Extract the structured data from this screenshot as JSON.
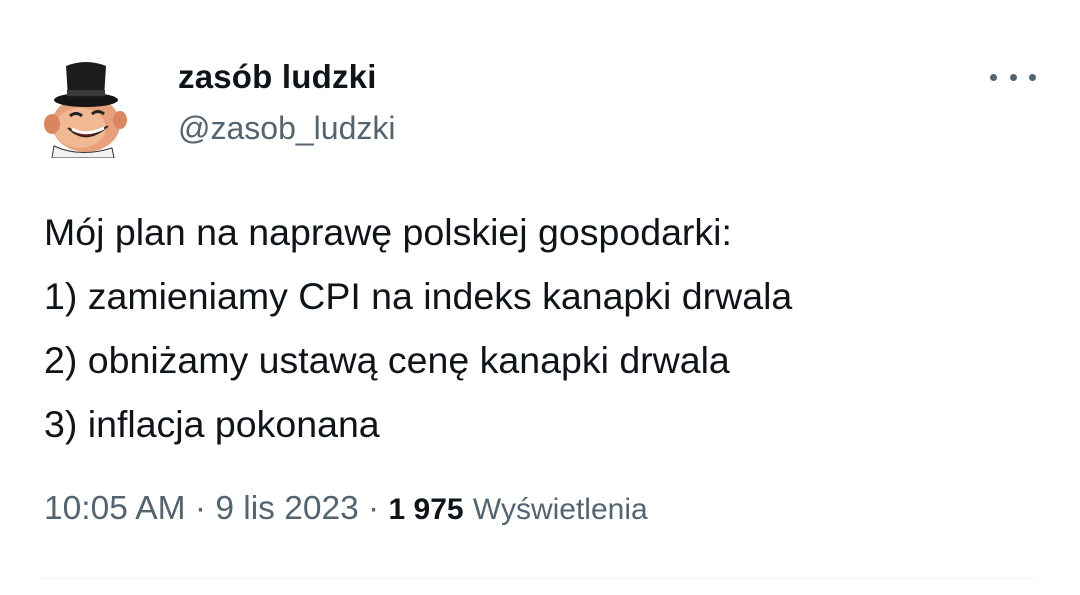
{
  "user": {
    "display_name": "zasób ludzki",
    "handle": "@zasob_ludzki",
    "avatar_icon": "top-hat-man-avatar"
  },
  "tweet": {
    "lines": [
      "Mój plan na naprawę polskiej gospodarki:",
      "1) zamieniamy CPI na indeks kanapki drwala",
      "2) obniżamy ustawą cenę kanapki drwala",
      "3) inflacja pokonana"
    ]
  },
  "meta": {
    "time": "10:05 AM",
    "separator": "·",
    "date": "9 lis 2023",
    "views_count": "1 975",
    "views_label": "Wyświetlenia"
  },
  "colors": {
    "text": "#0f1419",
    "secondary": "#536471",
    "divider": "#eff3f4"
  }
}
